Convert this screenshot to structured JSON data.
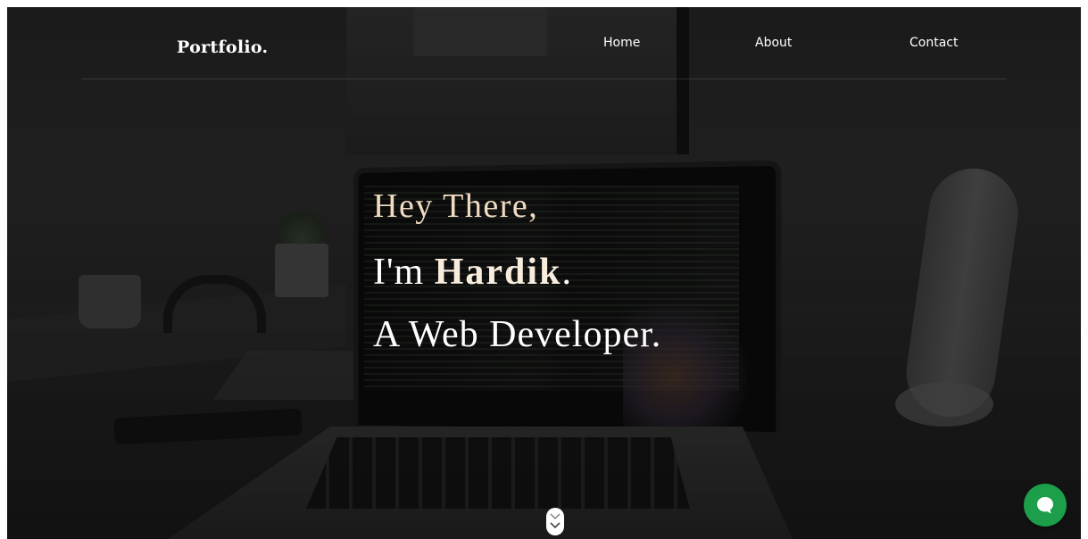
{
  "navbar": {
    "logo": "Portfolio.",
    "links": [
      {
        "label": "Home"
      },
      {
        "label": "About"
      },
      {
        "label": "Contact"
      }
    ]
  },
  "hero": {
    "greeting": "Hey There,",
    "intro_prefix": "I'm ",
    "name": "Hardik",
    "intro_suffix": ".",
    "role": "A Web Developer."
  },
  "icons": {
    "scroll": "chevron-down-icon",
    "chat": "chat-bubble-icon"
  },
  "colors": {
    "greeting": "#f1dcc2",
    "chat_button": "#1c9e4a"
  }
}
